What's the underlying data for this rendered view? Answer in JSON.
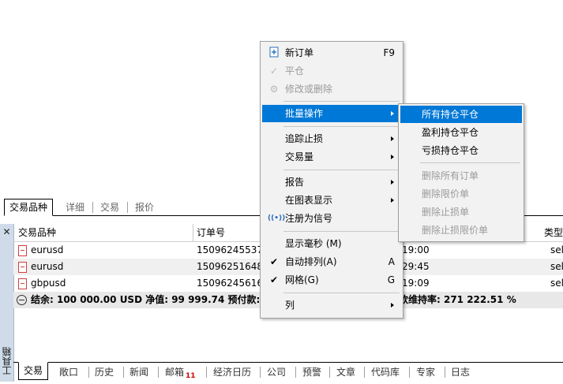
{
  "top_tabs": [
    {
      "label": "交易品种"
    },
    {
      "label": "详细"
    },
    {
      "label": "交易"
    },
    {
      "label": "报价"
    }
  ],
  "side_panel": {
    "close_glyph": "✕",
    "title": "工具箱"
  },
  "table": {
    "columns": [
      "交易品种",
      "订单号",
      "类型"
    ],
    "rows": [
      {
        "symbol": "eurusd",
        "order": "150962455372",
        "time": "19:00",
        "type": "sell"
      },
      {
        "symbol": "eurusd",
        "order": "150962516486",
        "time": "29:45",
        "type": "sell"
      },
      {
        "symbol": "gbpusd",
        "order": "150962456162",
        "time": "19:09",
        "type": "sell"
      }
    ],
    "summary_left": "结余: 100 000.00 USD  净值: 99 999.74  预付款: 36.8",
    "summary_right": "款维持率: 271 222.51 %"
  },
  "bottom_tabs": [
    {
      "label": "交易"
    },
    {
      "label": "敞口"
    },
    {
      "label": "历史"
    },
    {
      "label": "新闻"
    },
    {
      "label": "邮箱",
      "badge": "11"
    },
    {
      "label": "经济日历"
    },
    {
      "label": "公司"
    },
    {
      "label": "预警"
    },
    {
      "label": "文章"
    },
    {
      "label": "代码库"
    },
    {
      "label": "专家"
    },
    {
      "label": "日志"
    }
  ],
  "context_menu": {
    "new_order": {
      "label": "新订单",
      "shortcut": "F9"
    },
    "close": {
      "label": "平仓"
    },
    "modify": {
      "label": "修改或删除"
    },
    "bulk": {
      "label": "批量操作"
    },
    "trailing": {
      "label": "追踪止损"
    },
    "volume": {
      "label": "交易量"
    },
    "report": {
      "label": "报告"
    },
    "chart_show": {
      "label": "在图表显示"
    },
    "signal": {
      "label": "注册为信号"
    },
    "ms": {
      "label": "显示毫秒 (M)"
    },
    "autoarrange": {
      "label": "自动排列(A)",
      "shortcut": "A"
    },
    "grid": {
      "label": "网格(G)",
      "shortcut": "G"
    },
    "columns": {
      "label": "列"
    }
  },
  "submenu": {
    "close_all": "所有持仓平仓",
    "close_profit": "盈利持仓平仓",
    "close_loss": "亏损持仓平仓",
    "delete_all": "删除所有订单",
    "delete_limit": "删除限价单",
    "delete_stop": "删除止损单",
    "delete_stoplimit": "删除止损限价单"
  },
  "colors": {
    "highlight": "#0078d7",
    "side_panel": "#cfdbe8",
    "badge": "#d00000"
  }
}
